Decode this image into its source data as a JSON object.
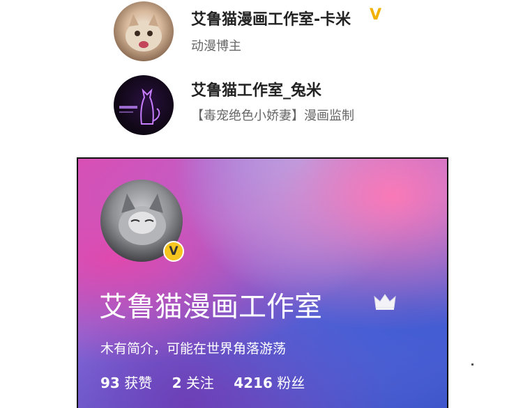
{
  "users": [
    {
      "name": "艾鲁猫漫画工作室-卡米",
      "verified_mark": "V",
      "subtitle": "动漫博主",
      "avatar_icon": "cat-avatar"
    },
    {
      "name": "艾鲁猫工作室_兔米",
      "subtitle": "【毒宠绝色小娇妻】漫画监制",
      "avatar_icon": "neon-cat-avatar"
    }
  ],
  "profile_card": {
    "name": "艾鲁猫漫画工作室",
    "verified_mark": "V",
    "bio": "木有简介，可能在世界角落游荡",
    "stats": [
      {
        "value": "93",
        "label": "获赞"
      },
      {
        "value": "2",
        "label": "关注"
      },
      {
        "value": "4216",
        "label": "粉丝"
      }
    ],
    "crown_icon": "crown-icon"
  },
  "colors": {
    "verified_gold": "#f2b100",
    "badge_yellow": "#f7c51f"
  }
}
